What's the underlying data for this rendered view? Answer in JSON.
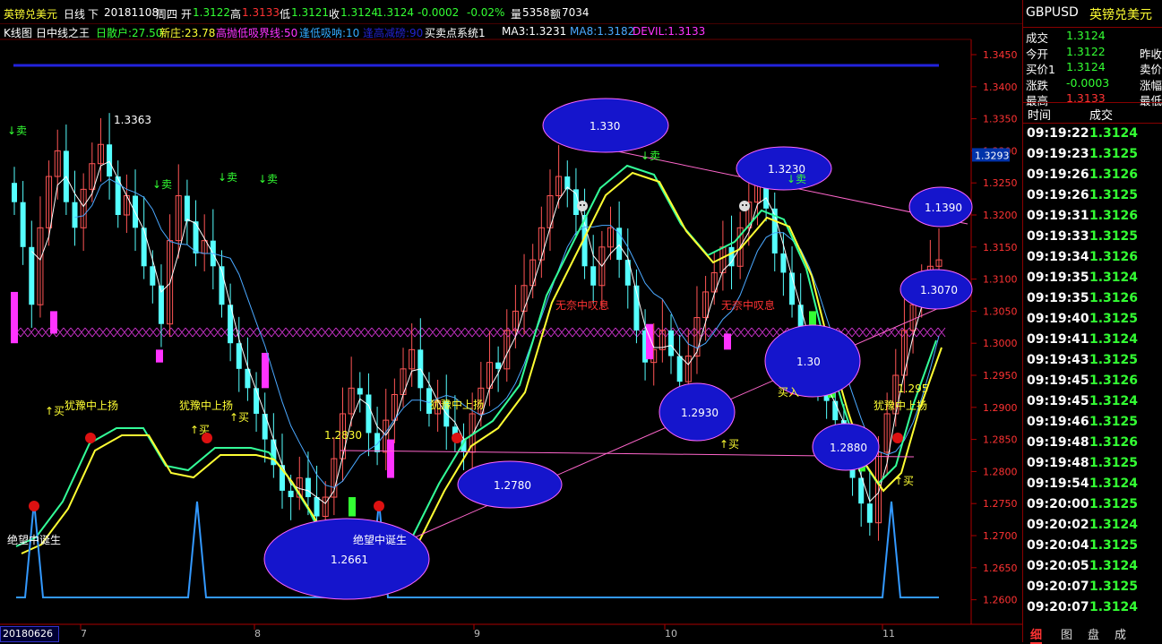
{
  "header": {
    "name": "英镑兑美元",
    "period": "日线",
    "nav": "下",
    "date": "20181108",
    "weekday": "周四",
    "open_label": "开",
    "open": "1.3122",
    "high_label": "高",
    "high": "1.3133",
    "low_label": "低",
    "low": "1.3121",
    "close_label": "收",
    "close": "1.3124",
    "last": "1.3124",
    "change": "-0.0002",
    "change_pct": "-0.02%",
    "vol_label": "量",
    "volume": "5358",
    "amt_label": "额",
    "amount": "7034"
  },
  "indicators": [
    {
      "text": "K线图",
      "color": "#ffffff"
    },
    {
      "text": "日中线之王",
      "color": "#ffffff"
    },
    {
      "text": "日散户:27.50",
      "color": "#33ff33"
    },
    {
      "text": "新庄:23.78",
      "color": "#ffff33"
    },
    {
      "text": "高抛低吸界线:50",
      "color": "#ff33ff"
    },
    {
      "text": "逢低吸呐:10",
      "color": "#33aaff"
    },
    {
      "text": "逢高减磅:90",
      "color": "#2222cc"
    },
    {
      "text": "买卖点系统1",
      "color": "#ffffff"
    },
    {
      "text": "MA3:1.3231",
      "color": "#ffffff"
    },
    {
      "text": "MA8:1.3182",
      "color": "#4aa8ff"
    },
    {
      "text": "DEVIL:1.3133",
      "color": "#ff33ff"
    }
  ],
  "price_axis": [
    "1.3450",
    "1.3400",
    "1.3350",
    "1.3300",
    "1.3250",
    "1.3200",
    "1.3150",
    "1.3100",
    "1.3050",
    "1.3000",
    "1.2950",
    "1.2900",
    "1.2850",
    "1.2800",
    "1.2750",
    "1.2700",
    "1.2650",
    "1.2600"
  ],
  "current_price_tag": "1.3293",
  "x_axis": {
    "start_date": "20180626",
    "labels": [
      "7",
      "8",
      "9",
      "10",
      "11"
    ]
  },
  "annotations": {
    "peak_label": "1.3363",
    "low_label_1": "1.2830",
    "ellipses": [
      "1.330",
      "1.3230",
      "1.1390",
      "1.3070",
      "1.2930",
      "1.2780",
      "1.2661",
      "1.30",
      "1.2880"
    ],
    "label_1295": "1.295",
    "sell": "↓卖",
    "buy": "↑买",
    "buy_in": "买入",
    "hesitate": "犹豫中上扬",
    "despair": "绝望中诞生",
    "sigh": "无奈中叹息"
  },
  "quote": {
    "symbol": "GBPUSD",
    "name": "英镑兑美元",
    "rows": [
      {
        "label": "成交",
        "value": "1.3124",
        "label2": "",
        "value_color": "#33ff33"
      },
      {
        "label": "今开",
        "value": "1.3122",
        "label2": "昨收",
        "value_color": "#33ff33"
      },
      {
        "label": "买价1",
        "value": "1.3124",
        "label2": "卖价",
        "value_color": "#33ff33"
      },
      {
        "label": "涨跌",
        "value": "-0.0003",
        "label2": "涨幅",
        "value_color": "#33ff33"
      },
      {
        "label": "最高",
        "value": "1.3133",
        "label2": "最低",
        "value_color": "#ff3333"
      }
    ]
  },
  "ticks_header": {
    "time": "时间",
    "price": "成交"
  },
  "ticks": [
    {
      "time": "09:19:22",
      "price": "1.3124"
    },
    {
      "time": "09:19:23",
      "price": "1.3125"
    },
    {
      "time": "09:19:26",
      "price": "1.3126"
    },
    {
      "time": "09:19:26",
      "price": "1.3125"
    },
    {
      "time": "09:19:31",
      "price": "1.3126"
    },
    {
      "time": "09:19:33",
      "price": "1.3125"
    },
    {
      "time": "09:19:34",
      "price": "1.3126"
    },
    {
      "time": "09:19:35",
      "price": "1.3124"
    },
    {
      "time": "09:19:35",
      "price": "1.3126"
    },
    {
      "time": "09:19:40",
      "price": "1.3125"
    },
    {
      "time": "09:19:41",
      "price": "1.3124"
    },
    {
      "time": "09:19:43",
      "price": "1.3125"
    },
    {
      "time": "09:19:45",
      "price": "1.3126"
    },
    {
      "time": "09:19:45",
      "price": "1.3124"
    },
    {
      "time": "09:19:46",
      "price": "1.3125"
    },
    {
      "time": "09:19:48",
      "price": "1.3126"
    },
    {
      "time": "09:19:48",
      "price": "1.3125"
    },
    {
      "time": "09:19:54",
      "price": "1.3124"
    },
    {
      "time": "09:20:00",
      "price": "1.3125"
    },
    {
      "time": "09:20:02",
      "price": "1.3124"
    },
    {
      "time": "09:20:04",
      "price": "1.3125"
    },
    {
      "time": "09:20:05",
      "price": "1.3124"
    },
    {
      "time": "09:20:07",
      "price": "1.3125"
    },
    {
      "time": "09:20:07",
      "price": "1.3124"
    }
  ],
  "tabs": [
    "细",
    "图",
    "盘",
    "成"
  ]
}
